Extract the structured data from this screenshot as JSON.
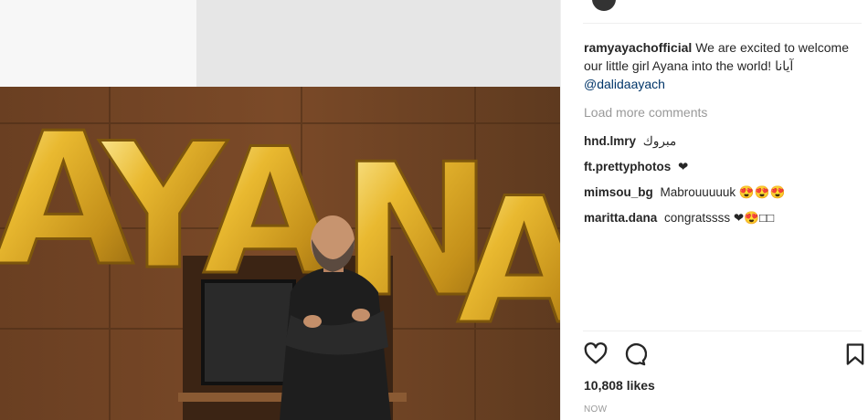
{
  "post": {
    "caption_user": "ramyayachofficial",
    "caption_text": "We are excited to welcome our little girl Ayana into the world! آيانا",
    "caption_mention": "@dalidaayach",
    "load_more": "Load more comments",
    "comments": [
      {
        "user": "hnd.lmry",
        "text": "مبروك"
      },
      {
        "user": "ft.prettyphotos",
        "text": "❤"
      },
      {
        "user": "mimsou_bg",
        "text": "Mabrouuuuuk 😍😍😍"
      },
      {
        "user": "maritta.dana",
        "text": "congratssss ❤😍□□"
      }
    ],
    "likes": "10,808 likes",
    "timestamp": "NOW"
  },
  "photo": {
    "balloon_letters": "AYANA",
    "balloon_color": "#d9a821"
  },
  "icons": {
    "like": "heart-icon",
    "comment": "speech-bubble-icon",
    "save": "bookmark-icon"
  }
}
